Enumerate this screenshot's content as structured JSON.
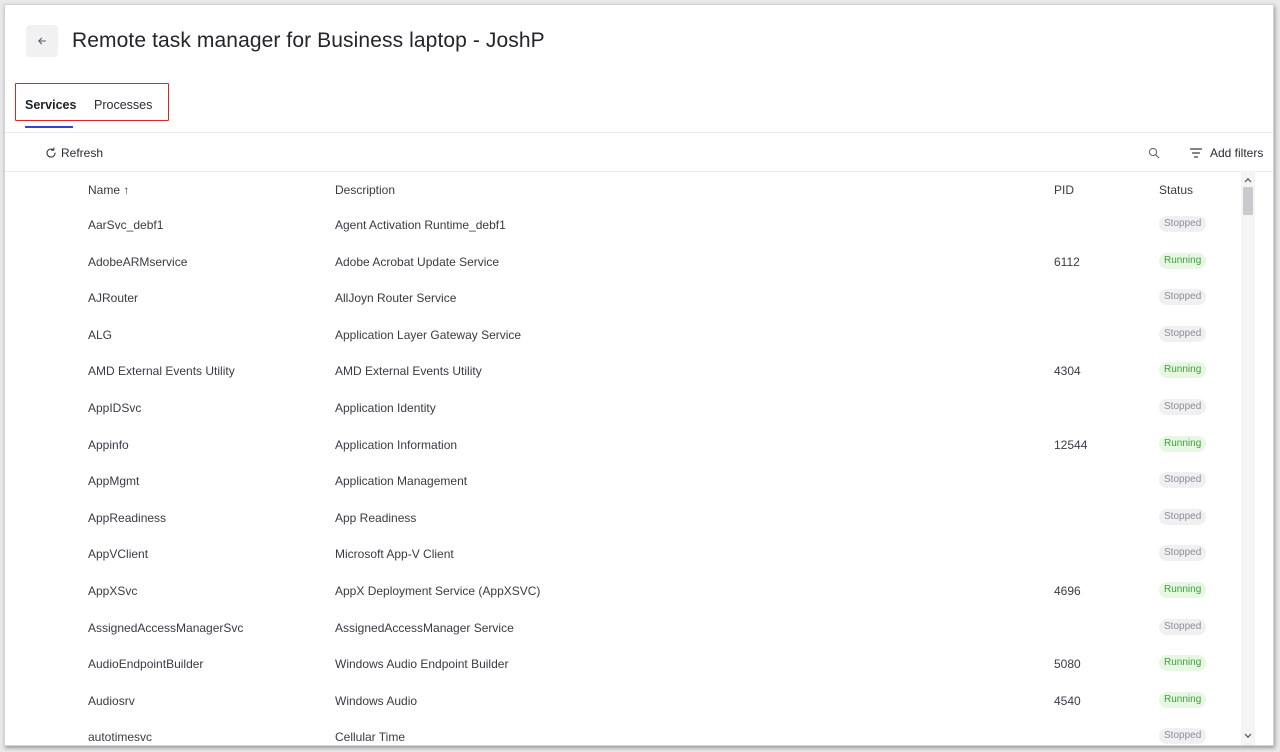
{
  "header": {
    "title": "Remote task manager for Business laptop - JoshP"
  },
  "tabs": [
    {
      "label": "Services",
      "active": true
    },
    {
      "label": "Processes",
      "active": false
    }
  ],
  "toolbar": {
    "refresh_label": "Refresh",
    "search_icon": "search-icon",
    "filters_label": "Add filters"
  },
  "table": {
    "columns": {
      "name": "Name ↑",
      "description": "Description",
      "pid": "PID",
      "status": "Status"
    },
    "rows": [
      {
        "name": "AarSvc_debf1",
        "description": "Agent Activation Runtime_debf1",
        "pid": "",
        "status": "Stopped"
      },
      {
        "name": "AdobeARMservice",
        "description": "Adobe Acrobat Update Service",
        "pid": "6112",
        "status": "Running"
      },
      {
        "name": "AJRouter",
        "description": "AllJoyn Router Service",
        "pid": "",
        "status": "Stopped"
      },
      {
        "name": "ALG",
        "description": "Application Layer Gateway Service",
        "pid": "",
        "status": "Stopped"
      },
      {
        "name": "AMD External Events Utility",
        "description": "AMD External Events Utility",
        "pid": "4304",
        "status": "Running"
      },
      {
        "name": "AppIDSvc",
        "description": "Application Identity",
        "pid": "",
        "status": "Stopped"
      },
      {
        "name": "Appinfo",
        "description": "Application Information",
        "pid": "12544",
        "status": "Running"
      },
      {
        "name": "AppMgmt",
        "description": "Application Management",
        "pid": "",
        "status": "Stopped"
      },
      {
        "name": "AppReadiness",
        "description": "App Readiness",
        "pid": "",
        "status": "Stopped"
      },
      {
        "name": "AppVClient",
        "description": "Microsoft App-V Client",
        "pid": "",
        "status": "Stopped"
      },
      {
        "name": "AppXSvc",
        "description": "AppX Deployment Service (AppXSVC)",
        "pid": "4696",
        "status": "Running"
      },
      {
        "name": "AssignedAccessManagerSvc",
        "description": "AssignedAccessManager Service",
        "pid": "",
        "status": "Stopped"
      },
      {
        "name": "AudioEndpointBuilder",
        "description": "Windows Audio Endpoint Builder",
        "pid": "5080",
        "status": "Running"
      },
      {
        "name": "Audiosrv",
        "description": "Windows Audio",
        "pid": "4540",
        "status": "Running"
      },
      {
        "name": "autotimesvc",
        "description": "Cellular Time",
        "pid": "",
        "status": "Stopped"
      }
    ]
  },
  "colors": {
    "accent": "#3346d3",
    "highlight_box": "#e02424",
    "running_bg": "#e8f7e4",
    "running_text": "#3aa23a",
    "stopped_bg": "#f0f0f3",
    "stopped_text": "#8c8c96"
  }
}
